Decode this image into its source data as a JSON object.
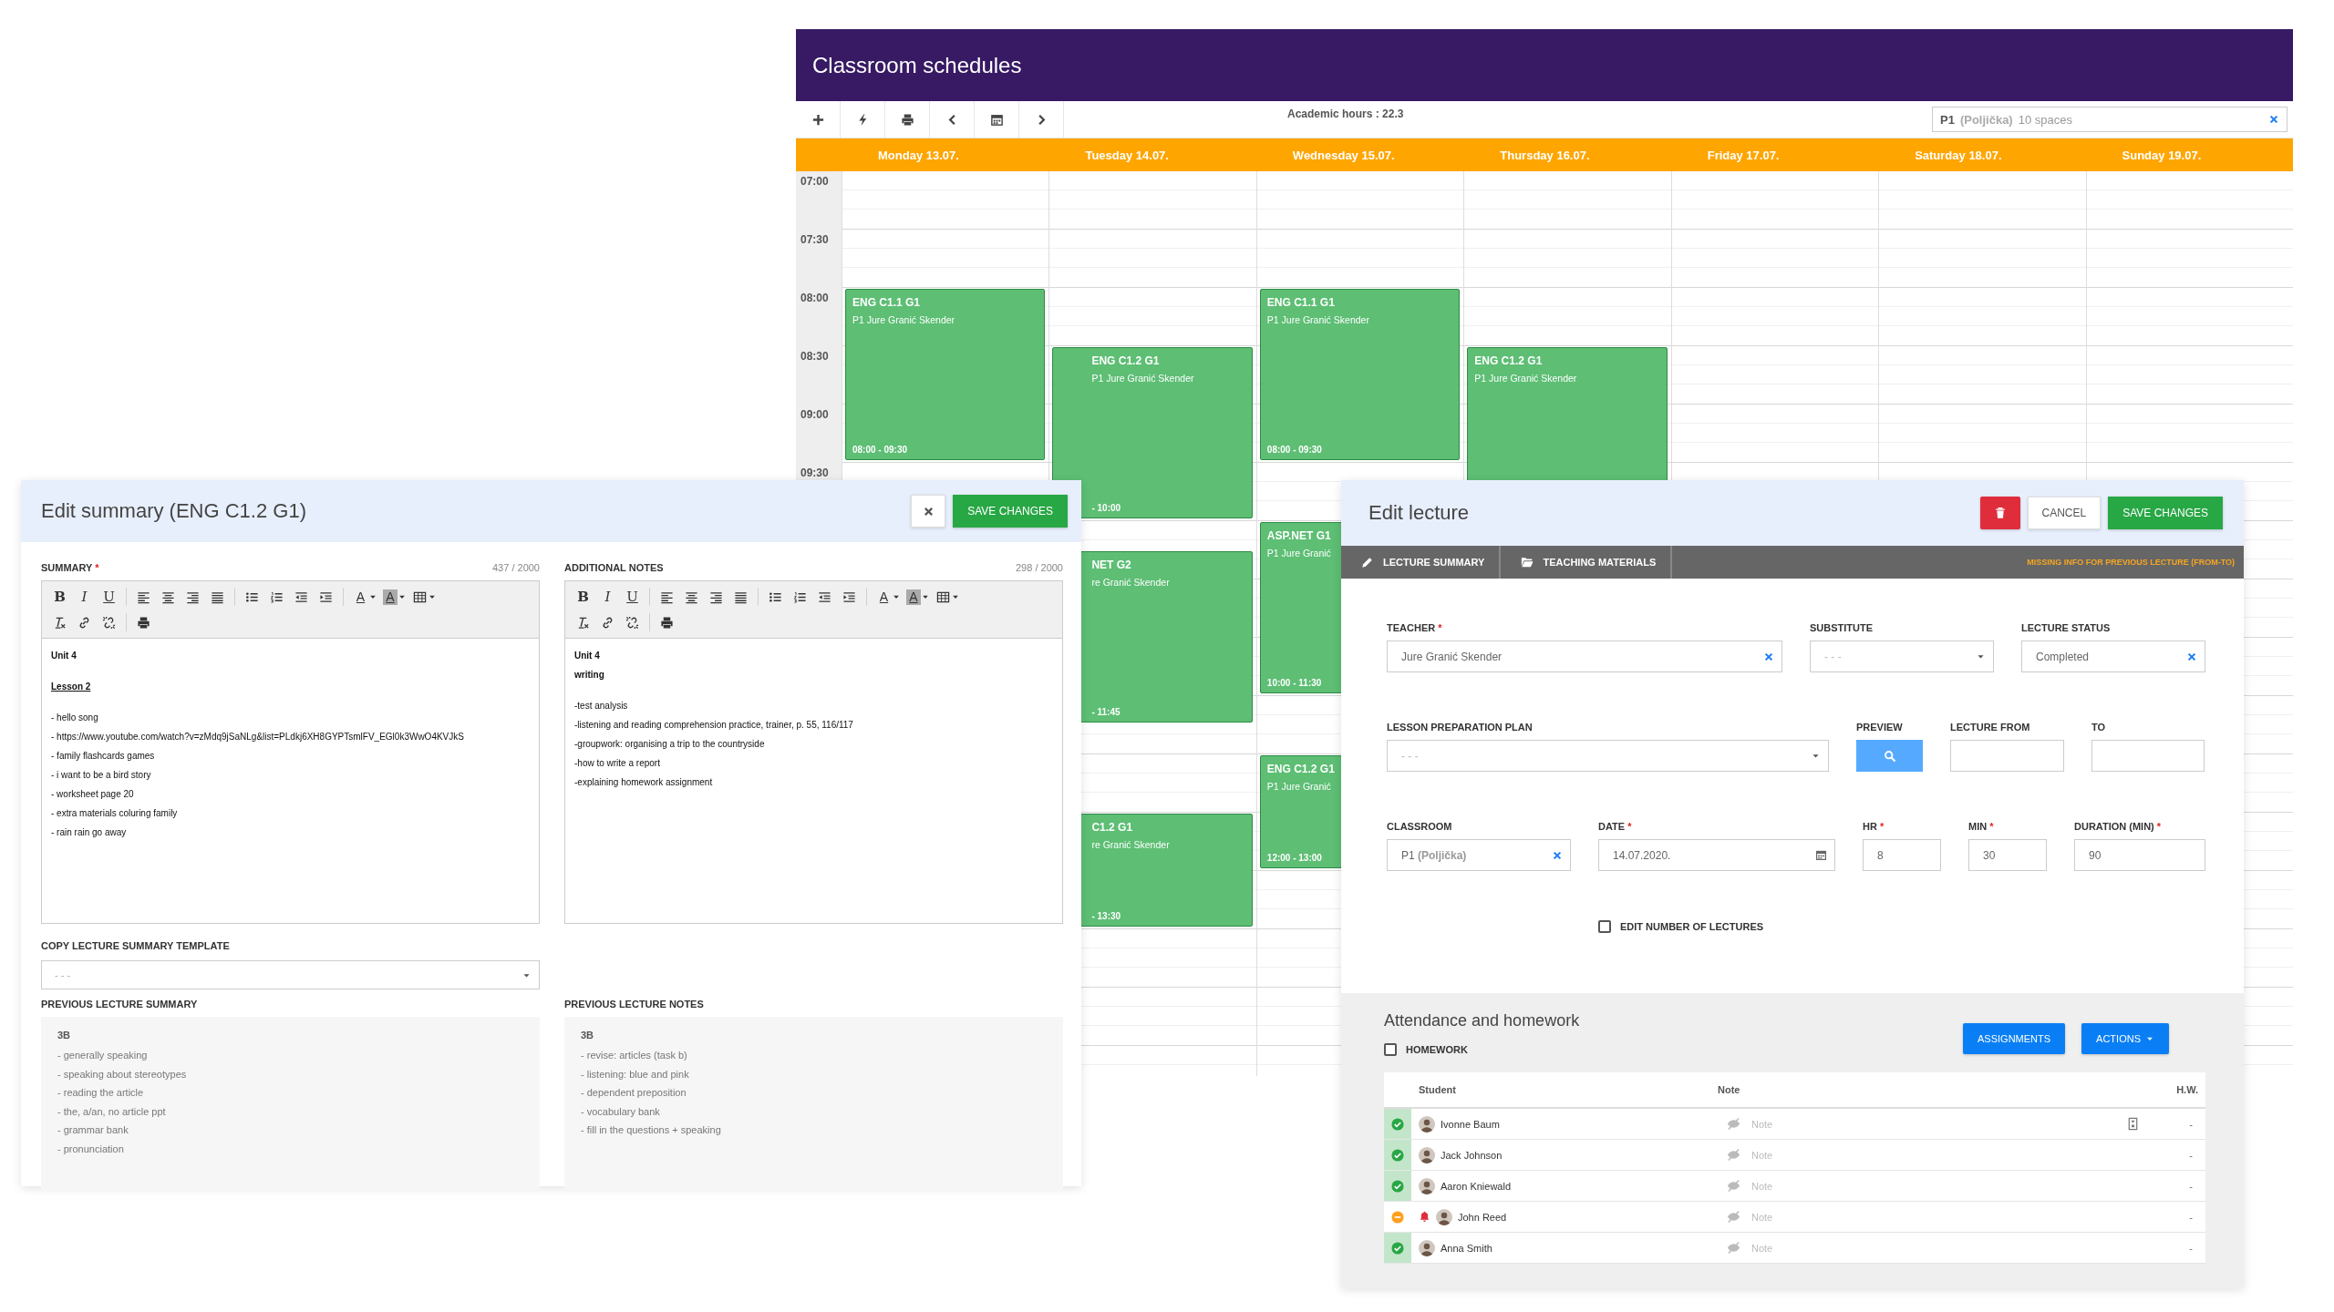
{
  "schedule": {
    "title": "Classroom schedules",
    "academic_hours": "Academic hours : 22.3",
    "room_filter": {
      "room": "P1",
      "room_name": "(Poljička)",
      "capacity": "10 spaces"
    },
    "times": [
      "07:00",
      "07:30",
      "08:00",
      "08:30",
      "09:00",
      "09:30"
    ],
    "days": [
      {
        "label": "Monday 13.07.",
        "events": [
          {
            "title": "ENG C1.1 G1",
            "teacher": "P1  Jure Granić Skender",
            "time": "08:00 - 09:30"
          }
        ]
      },
      {
        "label": "Tuesday 14.07.",
        "events": [
          {
            "title": "ENG C1.2 G1",
            "teacher": "P1  Jure Granić Skender",
            "time": "- 10:00"
          },
          {
            "title": "NET G2",
            "teacher": "re Granić Skender",
            "time": "- 11:45"
          },
          {
            "title": "C1.2 G1",
            "teacher": "re Granić Skender",
            "time": "- 13:30"
          }
        ]
      },
      {
        "label": "Wednesday 15.07.",
        "events": [
          {
            "title": "ENG C1.1 G1",
            "teacher": "P1  Jure Granić Skender",
            "time": "08:00 - 09:30"
          },
          {
            "title": "ASP.NET G1",
            "teacher": "P1  Jure Granić",
            "time": "10:00 - 11:30"
          },
          {
            "title": "ENG C1.2 G1",
            "teacher": "P1  Jure Granić",
            "time": "12:00 - 13:00"
          }
        ]
      },
      {
        "label": "Thursday 16.07.",
        "events": [
          {
            "title": "ENG C1.2 G1",
            "teacher": "P1  Jure Granić Skender"
          }
        ]
      },
      {
        "label": "Friday 17.07."
      },
      {
        "label": "Saturday 18.07."
      },
      {
        "label": "Sunday 19.07."
      }
    ]
  },
  "summary_dialog": {
    "title": "Edit summary (ENG C1.2 G1)",
    "save": "SAVE CHANGES",
    "editors": [
      {
        "label": "SUMMARY",
        "required_mark": "*",
        "counter": "437 / 2000",
        "toolbar": {
          "format": [
            "B",
            "I",
            "U"
          ],
          "color_tools": [
            "A",
            "A"
          ]
        },
        "lines": [
          {
            "kind": "heading",
            "text": "Unit 4"
          },
          {
            "kind": "underlined",
            "text": "Lesson 2",
            "spaced": true
          },
          {
            "kind": "line",
            "text": "- hello song",
            "spaced": true
          },
          {
            "kind": "line",
            "text": "- https://www.youtube.com/watch?v=zMdq9jSaNLg&list=PLdkj6XH8GYPTsmlFV_EGl0k3WwO4KVJkS"
          },
          {
            "kind": "line",
            "text": "- family flashcards games"
          },
          {
            "kind": "line",
            "text": "- i want to be a bird story"
          },
          {
            "kind": "line",
            "text": "- worksheet page 20"
          },
          {
            "kind": "line",
            "text": "- extra materials coluring family"
          },
          {
            "kind": "line",
            "text": "- rain rain go away"
          }
        ]
      },
      {
        "label": "ADDITIONAL NOTES",
        "counter": "298 / 2000",
        "toolbar": {
          "format": [
            "B",
            "I",
            "U"
          ],
          "color_tools": [
            "A",
            "A"
          ]
        },
        "lines": [
          {
            "kind": "heading",
            "text": "Unit 4"
          },
          {
            "kind": "heading",
            "text": "writing"
          },
          {
            "kind": "line",
            "text": "-test analysis",
            "spaced": true
          },
          {
            "kind": "line",
            "text": "-listening and reading comprehension practice, trainer, p. 55, 116/117"
          },
          {
            "kind": "line",
            "text": "-groupwork: organising a trip to the countryside"
          },
          {
            "kind": "line",
            "text": "-how to write a report"
          },
          {
            "kind": "line",
            "text": "-explaining homework assignment"
          }
        ]
      }
    ],
    "template": {
      "label": "COPY LECTURE SUMMARY TEMPLATE",
      "placeholder": "- - -"
    },
    "previous": [
      {
        "label": "PREVIOUS LECTURE SUMMARY",
        "heading": "3B",
        "lines": [
          "- generally speaking",
          "- speaking about stereotypes",
          "- reading the article",
          "- the, a/an, no article ppt",
          "- grammar bank",
          "- pronunciation"
        ]
      },
      {
        "label": "PREVIOUS LECTURE NOTES",
        "heading": "3B",
        "lines": [
          "- revise: articles (task b)",
          "- listening: blue and pink",
          "- dependent preposition",
          "- vocabulary bank",
          "- fill in the questions + speaking"
        ]
      }
    ]
  },
  "lecture_dialog": {
    "title": "Edit lecture",
    "cancel": "CANCEL",
    "save": "SAVE CHANGES",
    "tabs": [
      {
        "label": "LECTURE SUMMARY",
        "selected": false
      },
      {
        "label": "TEACHING MATERIALS",
        "selected": false
      }
    ],
    "warning": "MISSING INFO FOR PREVIOUS LECTURE (FROM-TO)",
    "fields": [
      {
        "label": "TEACHER",
        "required_mark": "*",
        "kind": "clearable",
        "value": "Jure Granić Skender"
      },
      {
        "label": "SUBSTITUTE",
        "kind": "select",
        "placeholder": "- - -"
      },
      {
        "label": "LECTURE STATUS",
        "kind": "clearable",
        "value": "Completed"
      },
      {
        "label": "LESSON PREPARATION PLAN",
        "kind": "select",
        "placeholder": "- - -"
      },
      {
        "label": "PREVIEW",
        "kind": "search-button"
      },
      {
        "label": "LECTURE FROM",
        "kind": "text"
      },
      {
        "label": "TO",
        "kind": "text"
      },
      {
        "label": "CLASSROOM",
        "kind": "clearable",
        "value": "P1",
        "value_detail": "(Poljička)"
      },
      {
        "label": "DATE",
        "required_mark": "*",
        "kind": "date",
        "value": "14.07.2020."
      },
      {
        "label": "HR",
        "required_mark": "*",
        "kind": "text",
        "value": "8"
      },
      {
        "label": "MIN",
        "required_mark": "*",
        "kind": "text",
        "value": "30"
      },
      {
        "label": "DURATION (MIN)",
        "required_mark": "*",
        "kind": "text",
        "value": "90"
      }
    ],
    "edit_count": {
      "label": "EDIT NUMBER OF LECTURES",
      "checked": false
    },
    "attendance": {
      "title": "Attendance and homework",
      "homework": {
        "label": "HOMEWORK",
        "checked": false
      },
      "buttons": [
        "ASSIGNMENTS",
        "ACTIONS"
      ],
      "columns": [
        "Student",
        "Note",
        "H.W."
      ],
      "rows": [
        {
          "kind": "present",
          "alert": false,
          "name": "Ivonne Baum",
          "note_placeholder": "Note",
          "attachment": true,
          "homework": "-"
        },
        {
          "kind": "present",
          "alert": false,
          "name": "Jack Johnson",
          "note_placeholder": "Note",
          "attachment": false,
          "homework": "-"
        },
        {
          "kind": "present",
          "alert": false,
          "name": "Aaron Kniewald",
          "note_placeholder": "Note",
          "attachment": false,
          "homework": "-"
        },
        {
          "kind": "late",
          "alert": true,
          "name": "John Reed",
          "note_placeholder": "Note",
          "attachment": false,
          "homework": "-"
        },
        {
          "kind": "present",
          "alert": false,
          "name": "Anna Smith",
          "note_placeholder": "Note",
          "attachment": false,
          "homework": "-"
        }
      ]
    }
  }
}
